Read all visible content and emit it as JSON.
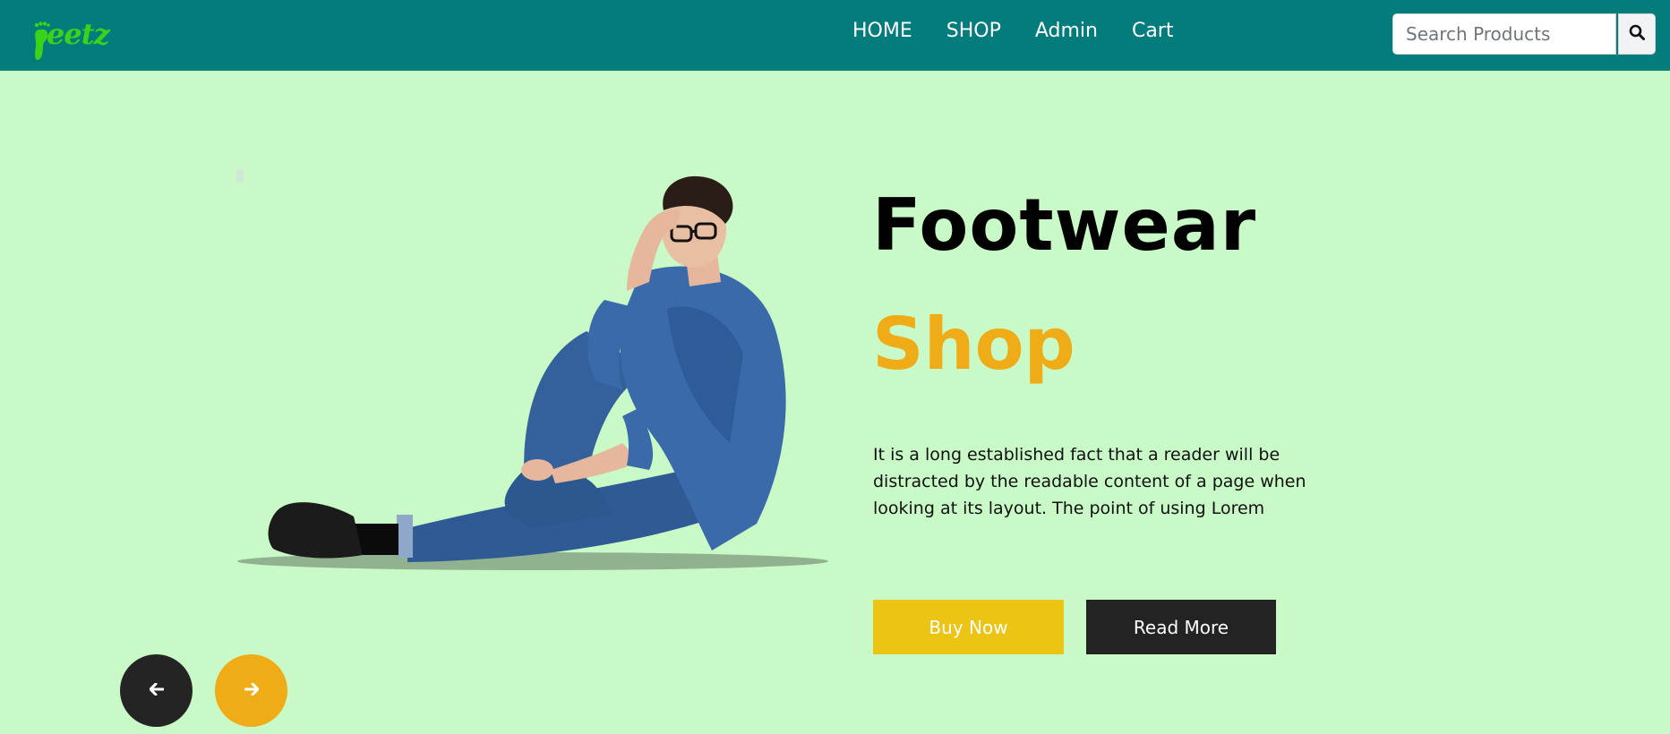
{
  "brand": {
    "name": "eetz",
    "logo_color": "#39d41a",
    "icon": "foot-icon"
  },
  "nav": {
    "items": [
      "HOME",
      "SHOP",
      "Admin",
      "Cart"
    ]
  },
  "search": {
    "placeholder": "Search Products",
    "icon": "search-icon"
  },
  "hero": {
    "title_line1": "Footwear",
    "title_line2": "Shop",
    "accent_color": "#efac17",
    "description": "It is a long established fact that a reader will be distracted by the readable content of a page when looking at its layout. The point of using Lorem",
    "buy_label": "Buy Now",
    "read_label": "Read More",
    "image": "man-sitting-in-denim-photo"
  },
  "carousel": {
    "prev_icon": "arrow-left-icon",
    "next_icon": "arrow-right-icon"
  },
  "colors": {
    "navbar": "#037c7c",
    "background": "#c8f9c6",
    "buy": "#ecc413",
    "read": "#232323"
  }
}
